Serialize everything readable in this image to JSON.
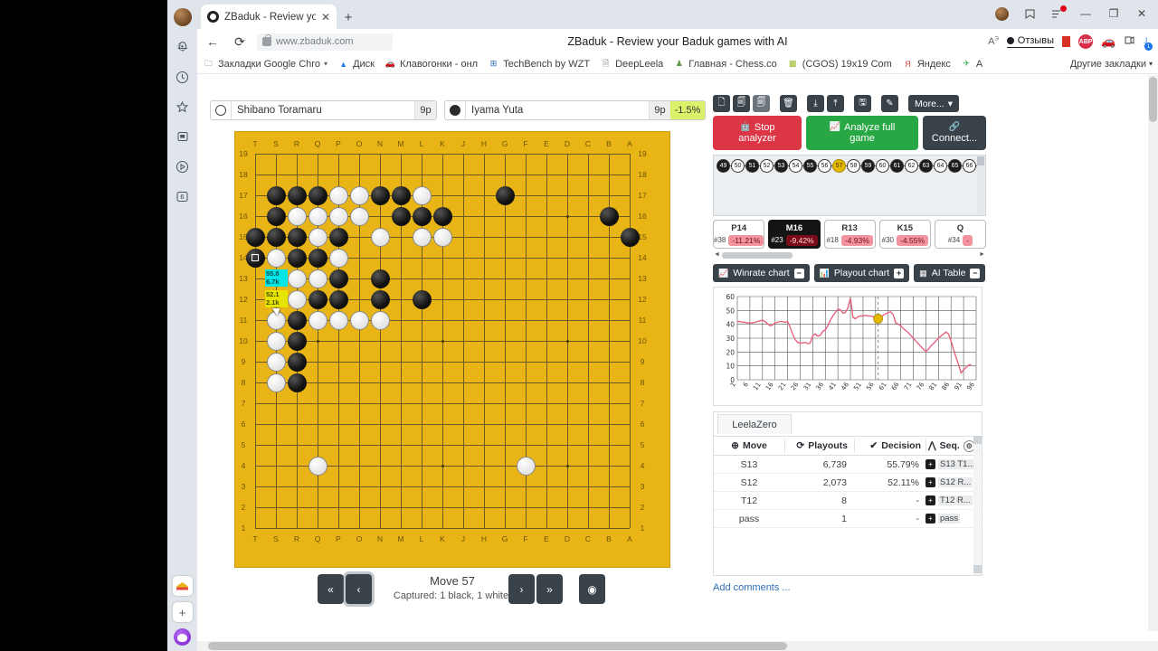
{
  "browser": {
    "tab": {
      "title": "ZBaduk - Review your B",
      "close": "✕"
    },
    "newtab_label": "+",
    "url": "www.zbaduk.com",
    "page_title": "ZBaduk - Review your Baduk games with AI",
    "translate_label": "A",
    "reviews_label": "Отзывы",
    "abp_label": "ABP",
    "download_badge": "1",
    "window": {
      "minimize": "—",
      "maximize": "❐",
      "close": "✕"
    },
    "bookmarks": [
      {
        "label": "Закладки Google Chro",
        "icon": "folder-icon"
      },
      {
        "label": "Диск",
        "icon": "drive-icon"
      },
      {
        "label": "Клавогонки - онл",
        "icon": "car-icon"
      },
      {
        "label": "TechBench by WZT",
        "icon": "windows-icon"
      },
      {
        "label": "DeepLeela",
        "icon": "page-icon"
      },
      {
        "label": "Главная - Chess.co",
        "icon": "chess-icon"
      },
      {
        "label": "(CGOS) 19x19 Com",
        "icon": "cgos-icon"
      },
      {
        "label": "Яндекс",
        "icon": "yandex-icon"
      },
      {
        "label": "A",
        "icon": "plane-icon"
      }
    ],
    "other_bookmarks": "Другие закладки"
  },
  "rail": {
    "items": [
      {
        "name": "avatar",
        "glyph": ""
      },
      {
        "name": "bell-icon",
        "glyph": "🔔"
      },
      {
        "name": "history-icon",
        "glyph": "🕐"
      },
      {
        "name": "star-icon",
        "glyph": "☆"
      },
      {
        "name": "notes-icon",
        "glyph": "🗒"
      },
      {
        "name": "play-icon",
        "glyph": "▷"
      },
      {
        "name": "panel-icon",
        "glyph": "6"
      }
    ],
    "add_label": "+"
  },
  "players": {
    "white": {
      "name": "Shibano Toramaru",
      "rank": "9p"
    },
    "black": {
      "name": "Iyama Yuta",
      "rank": "9p"
    },
    "score_diff": "-1.5%"
  },
  "board": {
    "size": 19,
    "col_labels": [
      "T",
      "S",
      "R",
      "Q",
      "P",
      "O",
      "N",
      "M",
      "L",
      "K",
      "J",
      "H",
      "G",
      "F",
      "E",
      "D",
      "C",
      "B",
      "A"
    ],
    "row_labels": [
      "19",
      "18",
      "17",
      "16",
      "15",
      "14",
      "13",
      "12",
      "11",
      "10",
      "9",
      "8",
      "7",
      "6",
      "5",
      "4",
      "3",
      "2",
      "1"
    ],
    "black_stones": [
      [
        17,
        1
      ],
      [
        17,
        2
      ],
      [
        17,
        3
      ],
      [
        17,
        6
      ],
      [
        17,
        7
      ],
      [
        17,
        12
      ],
      [
        16,
        1
      ],
      [
        16,
        7
      ],
      [
        16,
        8
      ],
      [
        16,
        9
      ],
      [
        16,
        17
      ],
      [
        15,
        0
      ],
      [
        15,
        1
      ],
      [
        15,
        2
      ],
      [
        15,
        4
      ],
      [
        15,
        18
      ],
      [
        14,
        0
      ],
      [
        14,
        2
      ],
      [
        14,
        3
      ],
      [
        13,
        4
      ],
      [
        13,
        6
      ],
      [
        12,
        3
      ],
      [
        12,
        4
      ],
      [
        12,
        6
      ],
      [
        12,
        8
      ],
      [
        11,
        2
      ],
      [
        10,
        2
      ],
      [
        9,
        2
      ],
      [
        8,
        2
      ]
    ],
    "white_stones": [
      [
        17,
        4
      ],
      [
        17,
        5
      ],
      [
        17,
        8
      ],
      [
        16,
        2
      ],
      [
        16,
        3
      ],
      [
        16,
        4
      ],
      [
        16,
        5
      ],
      [
        16,
        3
      ],
      [
        15,
        3
      ],
      [
        15,
        6
      ],
      [
        15,
        8
      ],
      [
        15,
        9
      ],
      [
        14,
        1
      ],
      [
        14,
        4
      ],
      [
        13,
        2
      ],
      [
        13,
        3
      ],
      [
        12,
        2
      ],
      [
        11,
        1
      ],
      [
        11,
        3
      ],
      [
        11,
        4
      ],
      [
        11,
        5
      ],
      [
        11,
        6
      ],
      [
        10,
        1
      ],
      [
        9,
        1
      ],
      [
        8,
        1
      ],
      [
        4,
        3
      ],
      [
        4,
        13
      ]
    ],
    "last_move": {
      "row": 14,
      "col": 0,
      "color": "black"
    },
    "suggestions": [
      {
        "row": 13,
        "col": 1,
        "winrate": "55.8",
        "playouts": "6.7k",
        "style": "cyan"
      },
      {
        "row": 12,
        "col": 1,
        "winrate": "52.1",
        "playouts": "2.1k",
        "style": "yellow"
      }
    ]
  },
  "controls": {
    "first": "«",
    "prev": "‹",
    "next": "›",
    "last": "»",
    "eye": "◉",
    "move_label": "Move 57",
    "captured_label": "Captured: 1 black, 1 white."
  },
  "toolbar": {
    "buttons": [
      {
        "name": "new-file-icon",
        "glyph": "🗋"
      },
      {
        "name": "copy-icon",
        "glyph": "🗐"
      },
      {
        "name": "duplicate-icon",
        "glyph": "🗐"
      },
      {
        "name": "trash-icon",
        "glyph": "🗑"
      },
      {
        "name": "download-icon",
        "glyph": "⤓"
      },
      {
        "name": "upload-icon",
        "glyph": "⤒"
      },
      {
        "name": "save-icon",
        "glyph": "🖫"
      },
      {
        "name": "pen-icon",
        "glyph": "✎"
      }
    ],
    "more_label": "More...",
    "more_caret": "▾"
  },
  "actions": {
    "stop": {
      "line1": "Stop",
      "line2": "analyzer",
      "icon": "robot-icon"
    },
    "analyze": {
      "line1": "Analyze full",
      "line2": "game",
      "icon": "chart-icon"
    },
    "connect": {
      "line1": "",
      "line2": "Connect...",
      "icon": "link-icon"
    }
  },
  "move_strip": {
    "moves": [
      {
        "n": "49",
        "color": "black"
      },
      {
        "n": "50",
        "color": "white"
      },
      {
        "n": "51",
        "color": "black"
      },
      {
        "n": "52",
        "color": "white"
      },
      {
        "n": "53",
        "color": "black"
      },
      {
        "n": "54",
        "color": "white"
      },
      {
        "n": "55",
        "color": "black"
      },
      {
        "n": "56",
        "color": "white"
      },
      {
        "n": "57",
        "color": "current"
      },
      {
        "n": "58",
        "color": "white"
      },
      {
        "n": "59",
        "color": "black"
      },
      {
        "n": "60",
        "color": "white"
      },
      {
        "n": "61",
        "color": "black"
      },
      {
        "n": "62",
        "color": "white"
      },
      {
        "n": "63",
        "color": "black"
      },
      {
        "n": "64",
        "color": "white"
      },
      {
        "n": "65",
        "color": "black"
      },
      {
        "n": "66",
        "color": "white"
      }
    ]
  },
  "key_moves": [
    {
      "move": "P14",
      "index": "#38",
      "delta": "-11.21%",
      "dark": false
    },
    {
      "move": "M16",
      "index": "#23",
      "delta": "-9.42%",
      "dark": true
    },
    {
      "move": "R13",
      "index": "#18",
      "delta": "-4.93%",
      "dark": false
    },
    {
      "move": "K15",
      "index": "#30",
      "delta": "-4.55%",
      "dark": false
    },
    {
      "move": "Q",
      "index": "#34",
      "delta": "-",
      "dark": false
    }
  ],
  "chart_buttons": [
    {
      "label": "Winrate chart",
      "sign": "−",
      "icon": "line-chart-icon"
    },
    {
      "label": "Playout chart",
      "sign": "+",
      "icon": "bar-chart-icon"
    },
    {
      "label": "AI Table",
      "sign": "−",
      "icon": "table-icon"
    }
  ],
  "chart_data": {
    "type": "line",
    "title": "Winrate chart",
    "xlabel": "",
    "ylabel": "",
    "ylim": [
      0,
      60
    ],
    "yticks": [
      0,
      10,
      20,
      30,
      40,
      50,
      60
    ],
    "xticks": [
      "1",
      "6",
      "11",
      "16",
      "21",
      "26",
      "31",
      "36",
      "41",
      "46",
      "51",
      "56",
      "61",
      "66",
      "71",
      "76",
      "81",
      "86",
      "91",
      "96"
    ],
    "xlim": [
      1,
      96
    ],
    "grid": true,
    "line_color": "#e8637f",
    "marker": {
      "x": 57,
      "y": 44,
      "color": "#e5b800",
      "label": "current move"
    },
    "vline": {
      "x": 57,
      "style": "dashed",
      "color": "#888"
    },
    "x": [
      1,
      2,
      3,
      4,
      5,
      6,
      7,
      8,
      9,
      10,
      11,
      12,
      13,
      14,
      15,
      16,
      17,
      18,
      19,
      20,
      21,
      22,
      23,
      24,
      25,
      26,
      27,
      28,
      29,
      30,
      31,
      32,
      33,
      34,
      35,
      36,
      37,
      38,
      39,
      40,
      41,
      42,
      43,
      44,
      45,
      46,
      47,
      48,
      49,
      50,
      51,
      52,
      53,
      54,
      55,
      56,
      57,
      58,
      59,
      60,
      61,
      62,
      63,
      64,
      65,
      66,
      67,
      68,
      69,
      70,
      71,
      72,
      73,
      74,
      75,
      76,
      77,
      78,
      79,
      80,
      81,
      82,
      83,
      84,
      85,
      86,
      87,
      88,
      89,
      90,
      91,
      92,
      93,
      94,
      95,
      96
    ],
    "values": [
      42,
      42,
      41.5,
      41.5,
      41,
      41,
      41,
      41.5,
      42,
      42.5,
      43,
      42,
      40.5,
      39,
      39.5,
      41,
      41.5,
      42,
      42,
      41.5,
      42,
      38,
      33,
      29,
      27,
      26.5,
      26.5,
      27,
      26,
      26.5,
      32,
      33,
      31.5,
      32,
      35,
      36,
      39,
      43,
      46,
      48.5,
      51,
      50.5,
      48,
      48.5,
      52,
      59,
      45,
      44,
      45.5,
      46,
      46,
      46.5,
      46,
      46,
      45.5,
      45,
      44,
      45,
      46.5,
      47.5,
      48.5,
      49,
      47,
      41,
      40,
      39,
      37,
      35.5,
      34,
      32,
      30,
      28,
      26,
      24,
      22,
      20.5,
      22,
      24.5,
      26,
      28,
      30,
      31.5,
      33,
      34.5,
      33,
      28,
      22,
      16,
      11,
      5,
      7,
      9,
      10.5,
      11
    ]
  },
  "ai_table": {
    "engine_tab": "LeelaZero",
    "columns": [
      "Move",
      "Playouts",
      "Decision",
      "Seq."
    ],
    "rows": [
      {
        "move": "S13",
        "playouts": "6,739",
        "decision": "55.79%",
        "seq": "S13 T1..."
      },
      {
        "move": "S12",
        "playouts": "2,073",
        "decision": "52.11%",
        "seq": "S12 R..."
      },
      {
        "move": "T12",
        "playouts": "8",
        "decision": "-",
        "seq": "T12 R..."
      },
      {
        "move": "pass",
        "playouts": "1",
        "decision": "-",
        "seq": "pass"
      }
    ],
    "add_comments": "Add comments ..."
  }
}
